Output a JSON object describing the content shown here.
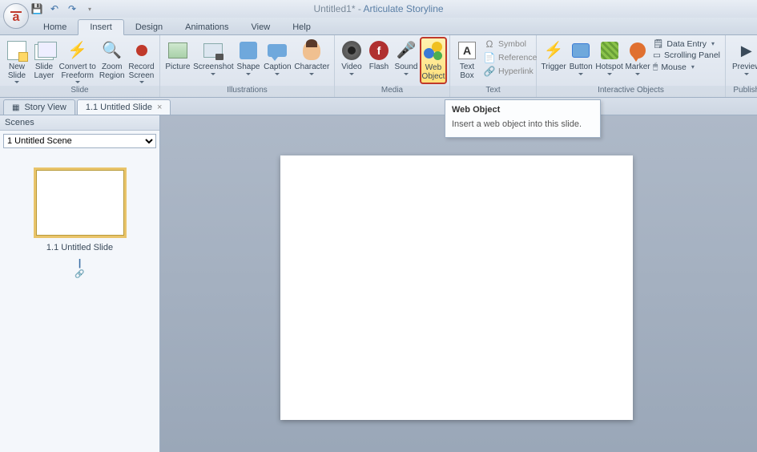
{
  "title": {
    "doc": "Untitled1* - ",
    "app": "Articulate Storyline"
  },
  "tabs": {
    "home": "Home",
    "insert": "Insert",
    "design": "Design",
    "animations": "Animations",
    "view": "View",
    "help": "Help"
  },
  "groups": {
    "slide": {
      "label": "Slide",
      "new_slide": "New\nSlide",
      "slide_layer": "Slide\nLayer",
      "convert": "Convert to\nFreeform",
      "zoom": "Zoom\nRegion",
      "record": "Record\nScreen"
    },
    "illus": {
      "label": "Illustrations",
      "picture": "Picture",
      "screenshot": "Screenshot",
      "shape": "Shape",
      "caption": "Caption",
      "character": "Character"
    },
    "media": {
      "label": "Media",
      "video": "Video",
      "flash": "Flash",
      "sound": "Sound",
      "web": "Web\nObject"
    },
    "text": {
      "label": "Text",
      "textbox": "Text\nBox",
      "symbol": "Symbol",
      "reference": "Reference",
      "hyperlink": "Hyperlink"
    },
    "inter": {
      "label": "Interactive Objects",
      "trigger": "Trigger",
      "button": "Button",
      "hotspot": "Hotspot",
      "marker": "Marker",
      "data_entry": "Data Entry",
      "scrolling": "Scrolling Panel",
      "mouse": "Mouse"
    },
    "publish": {
      "label": "Publish",
      "preview": "Preview"
    }
  },
  "tooltip": {
    "title": "Web Object",
    "body": "Insert a web object into this slide."
  },
  "doctabs": {
    "story": "Story View",
    "slide": "1.1 Untitled Slide"
  },
  "side": {
    "header": "Scenes",
    "scene": "1 Untitled Scene",
    "thumb_label": "1.1 Untitled Slide"
  }
}
